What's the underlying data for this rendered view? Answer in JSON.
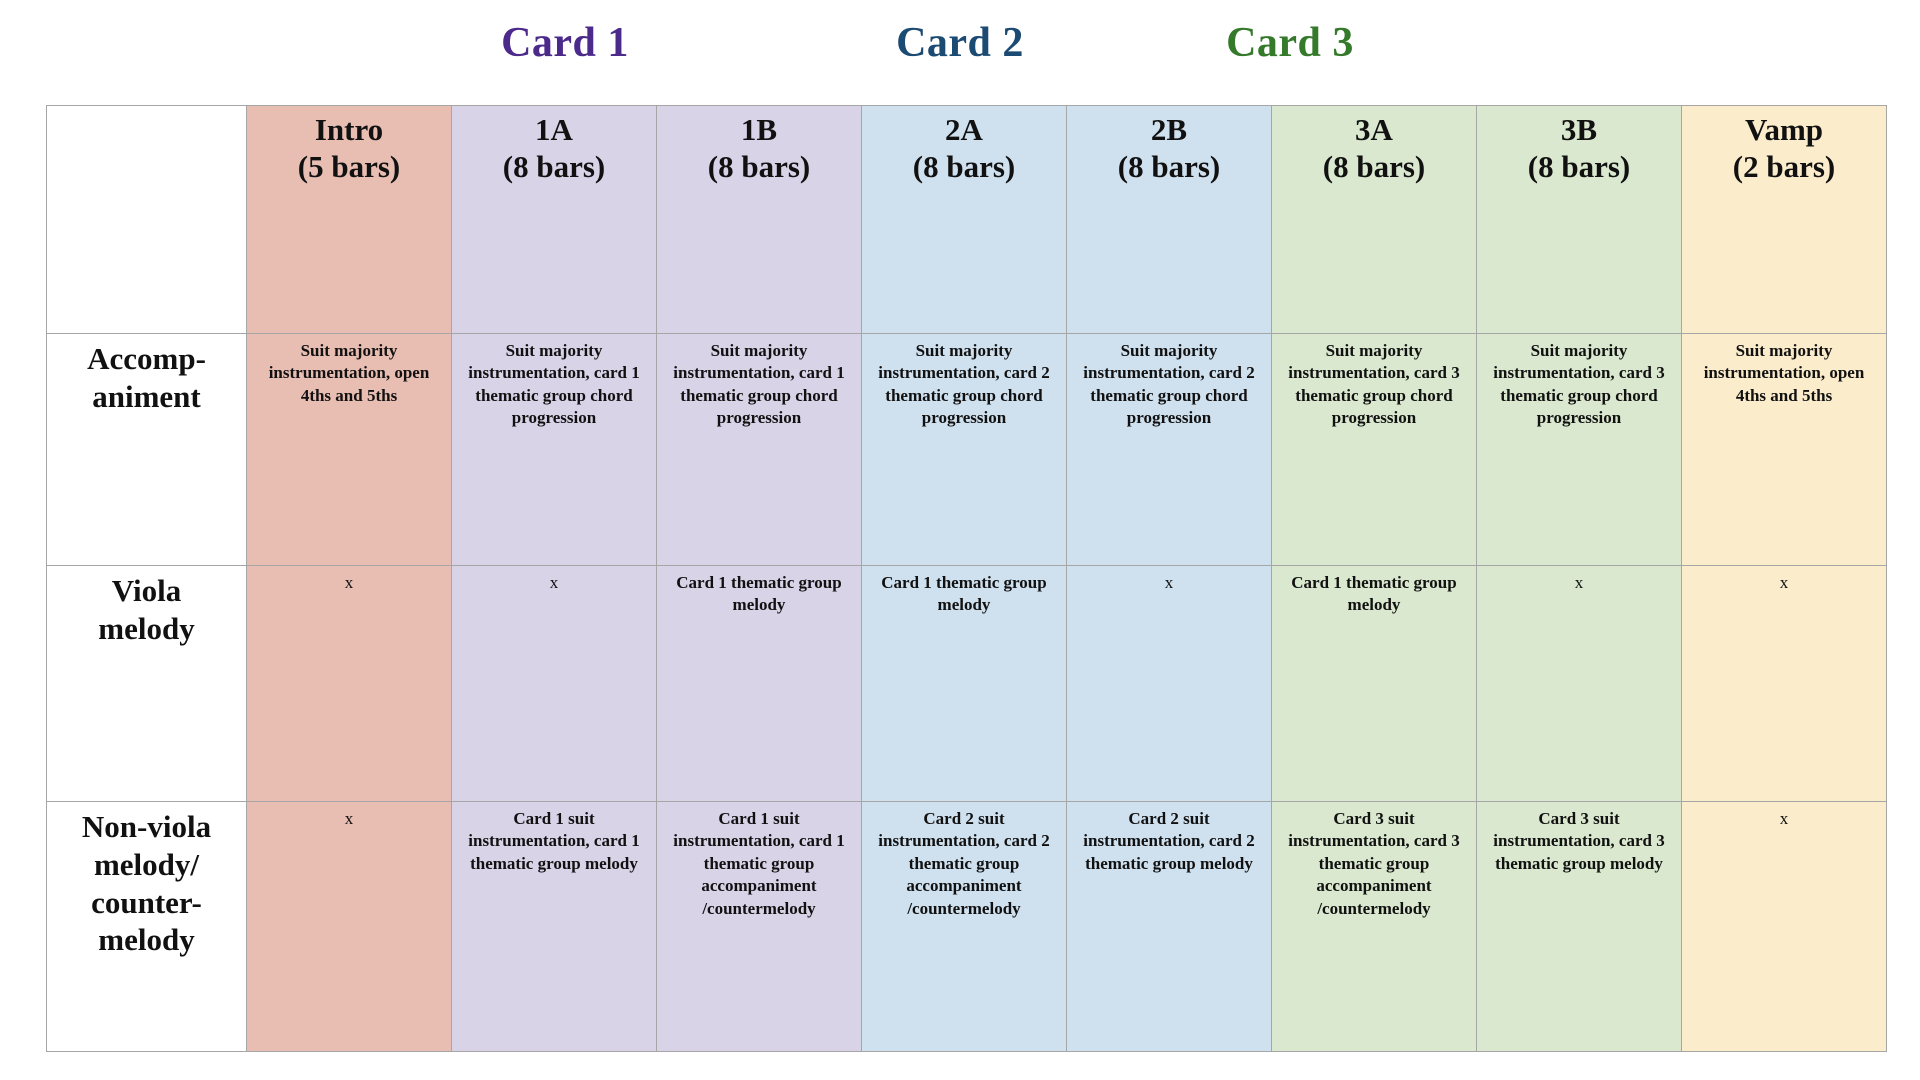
{
  "card_labels": [
    {
      "text": "Card 1",
      "color": "#4b2a8c"
    },
    {
      "text": "Card 2",
      "color": "#1b4a72"
    },
    {
      "text": "Card 3",
      "color": "#357a2b"
    }
  ],
  "colors": {
    "intro": "#e8bdb2",
    "card1": "#d9d3e8",
    "card2": "#cfe0ef",
    "card3": "#d9e8ce",
    "vamp": "#fbeccb",
    "border": "#a6a6a6",
    "text": "#111111",
    "background": "#ffffff"
  },
  "table": {
    "corner_label": "",
    "columns": [
      {
        "name": "Intro",
        "bars": "(5 bars)",
        "fill": "#e8bdb2"
      },
      {
        "name": "1A",
        "bars": "(8 bars)",
        "fill": "#d9d3e8"
      },
      {
        "name": "1B",
        "bars": "(8 bars)",
        "fill": "#d9d3e8"
      },
      {
        "name": "2A",
        "bars": "(8 bars)",
        "fill": "#cfe0ef"
      },
      {
        "name": "2B",
        "bars": "(8 bars)",
        "fill": "#cfe0ef"
      },
      {
        "name": "3A",
        "bars": "(8 bars)",
        "fill": "#d9e8ce"
      },
      {
        "name": "3B",
        "bars": "(8 bars)",
        "fill": "#d9e8ce"
      },
      {
        "name": "Vamp",
        "bars": "(2 bars)",
        "fill": "#fbeccb"
      }
    ],
    "rows": [
      {
        "label": "Accomp-\naniment",
        "label_lines": [
          "Accomp-",
          "animent"
        ],
        "cells": [
          "Suit majority instrumentation, open 4ths and 5ths",
          "Suit majority instrumentation, card 1 thematic group chord progression",
          "Suit majority instrumentation, card 1 thematic group chord progression",
          "Suit majority instrumentation, card 2 thematic group chord progression",
          "Suit majority instrumentation, card 2 thematic group chord progression",
          "Suit majority instrumentation, card 3 thematic group chord progression",
          "Suit majority instrumentation, card 3 thematic group chord progression",
          "Suit majority instrumentation, open 4ths and 5ths"
        ]
      },
      {
        "label": "Viola melody",
        "label_lines": [
          "Viola",
          "melody"
        ],
        "cells": [
          "x",
          "x",
          "Card 1 thematic group melody",
          "Card 1 thematic group melody",
          "x",
          "Card 1 thematic group melody",
          "x",
          "x"
        ]
      },
      {
        "label": "Non-viola melody/ counter-melody",
        "label_lines": [
          "Non-viola",
          "melody/",
          "counter-",
          "melody"
        ],
        "cells": [
          "x",
          "Card 1 suit instrumentation, card 1 thematic group melody",
          "Card 1 suit instrumentation, card 1 thematic group accompaniment /countermelody",
          "Card 2 suit instrumentation, card 2 thematic group accompaniment /countermelody",
          "Card 2 suit instrumentation, card 2 thematic group melody",
          "Card 3 suit instrumentation, card 3 thematic group accompaniment /countermelody",
          "Card 3 suit instrumentation, card 3 thematic group melody",
          "x"
        ]
      }
    ]
  }
}
